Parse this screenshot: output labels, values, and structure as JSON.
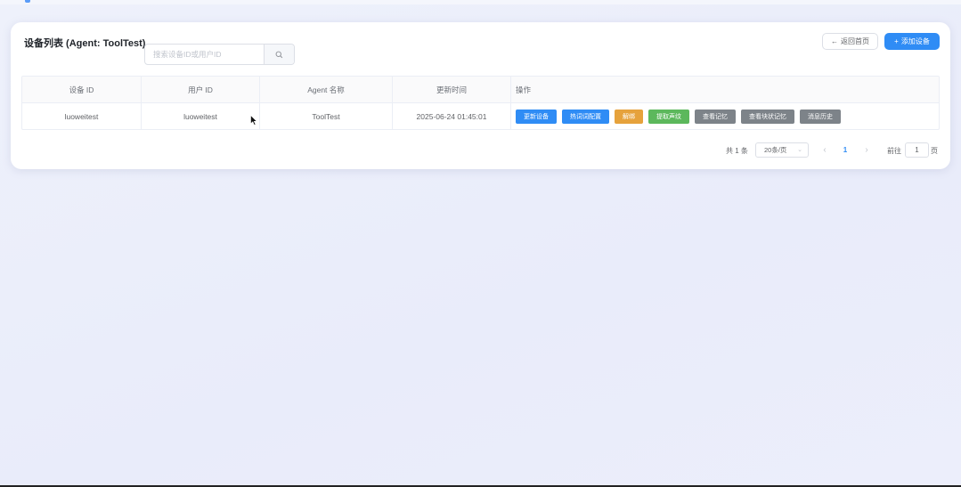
{
  "page": {
    "title": "设备列表 (Agent: ToolTest)"
  },
  "search": {
    "placeholder": "搜索设备ID或用户ID",
    "button_icon": "search-icon"
  },
  "header_buttons": {
    "back_label": "返回首页",
    "back_icon": "arrow-left-icon",
    "add_label": "添加设备",
    "add_icon": "plus-icon"
  },
  "table": {
    "columns": [
      "设备 ID",
      "用户 ID",
      "Agent 名称",
      "更新时间",
      "操作"
    ],
    "rows": [
      {
        "device_id": "luoweitest",
        "user_id": "luoweitest",
        "agent_name": "ToolTest",
        "updated_at": "2025-06-24 01:45:01",
        "actions": [
          {
            "label": "更新设备",
            "color": "#2f8cf5"
          },
          {
            "label": "热词词配置",
            "color": "#2f8cf5"
          },
          {
            "label": "解绑",
            "color": "#e6a23c"
          },
          {
            "label": "提取声纹",
            "color": "#5cb85c"
          },
          {
            "label": "查看记忆",
            "color": "#7d8389"
          },
          {
            "label": "查看块状记忆",
            "color": "#7d8389"
          },
          {
            "label": "消息历史",
            "color": "#7d8389"
          }
        ]
      }
    ]
  },
  "pagination": {
    "total_text": "共 1 条",
    "page_size": "20条/页",
    "current_page": "1",
    "goto_label": "前往",
    "goto_value": "1",
    "goto_suffix": "页"
  },
  "colors": {
    "primary": "#2f8cf5",
    "warning": "#e6a23c",
    "success": "#5cb85c",
    "info": "#7d8389"
  }
}
